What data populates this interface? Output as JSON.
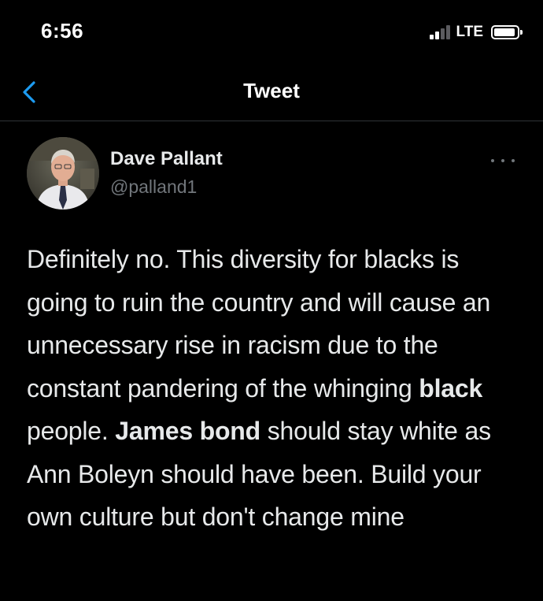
{
  "status_bar": {
    "time": "6:56",
    "network": "LTE",
    "signal_bars_active": 2,
    "signal_bars_total": 4
  },
  "header": {
    "title": "Tweet",
    "back_icon": "chevron-left-icon",
    "accent_color": "#1d9bf0"
  },
  "tweet": {
    "author_name": "Dave Pallant",
    "author_handle": "@palland1",
    "more_icon": "more-horizontal-icon",
    "text_segments": [
      {
        "text": "Definitely no. This diversity for blacks is going to ruin the country and will cause an unnecessary rise in racism due to the constant pandering of the whinging ",
        "bold": false
      },
      {
        "text": "black",
        "bold": true
      },
      {
        "text": " people. ",
        "bold": false
      },
      {
        "text": "James bond",
        "bold": true
      },
      {
        "text": " should stay white as Ann Boleyn should have been. Build your own culture but don't change mine",
        "bold": false
      }
    ]
  },
  "colors": {
    "background": "#000000",
    "text_primary": "#e7e9ea",
    "text_secondary": "#71767b",
    "divider": "#2f3336"
  }
}
